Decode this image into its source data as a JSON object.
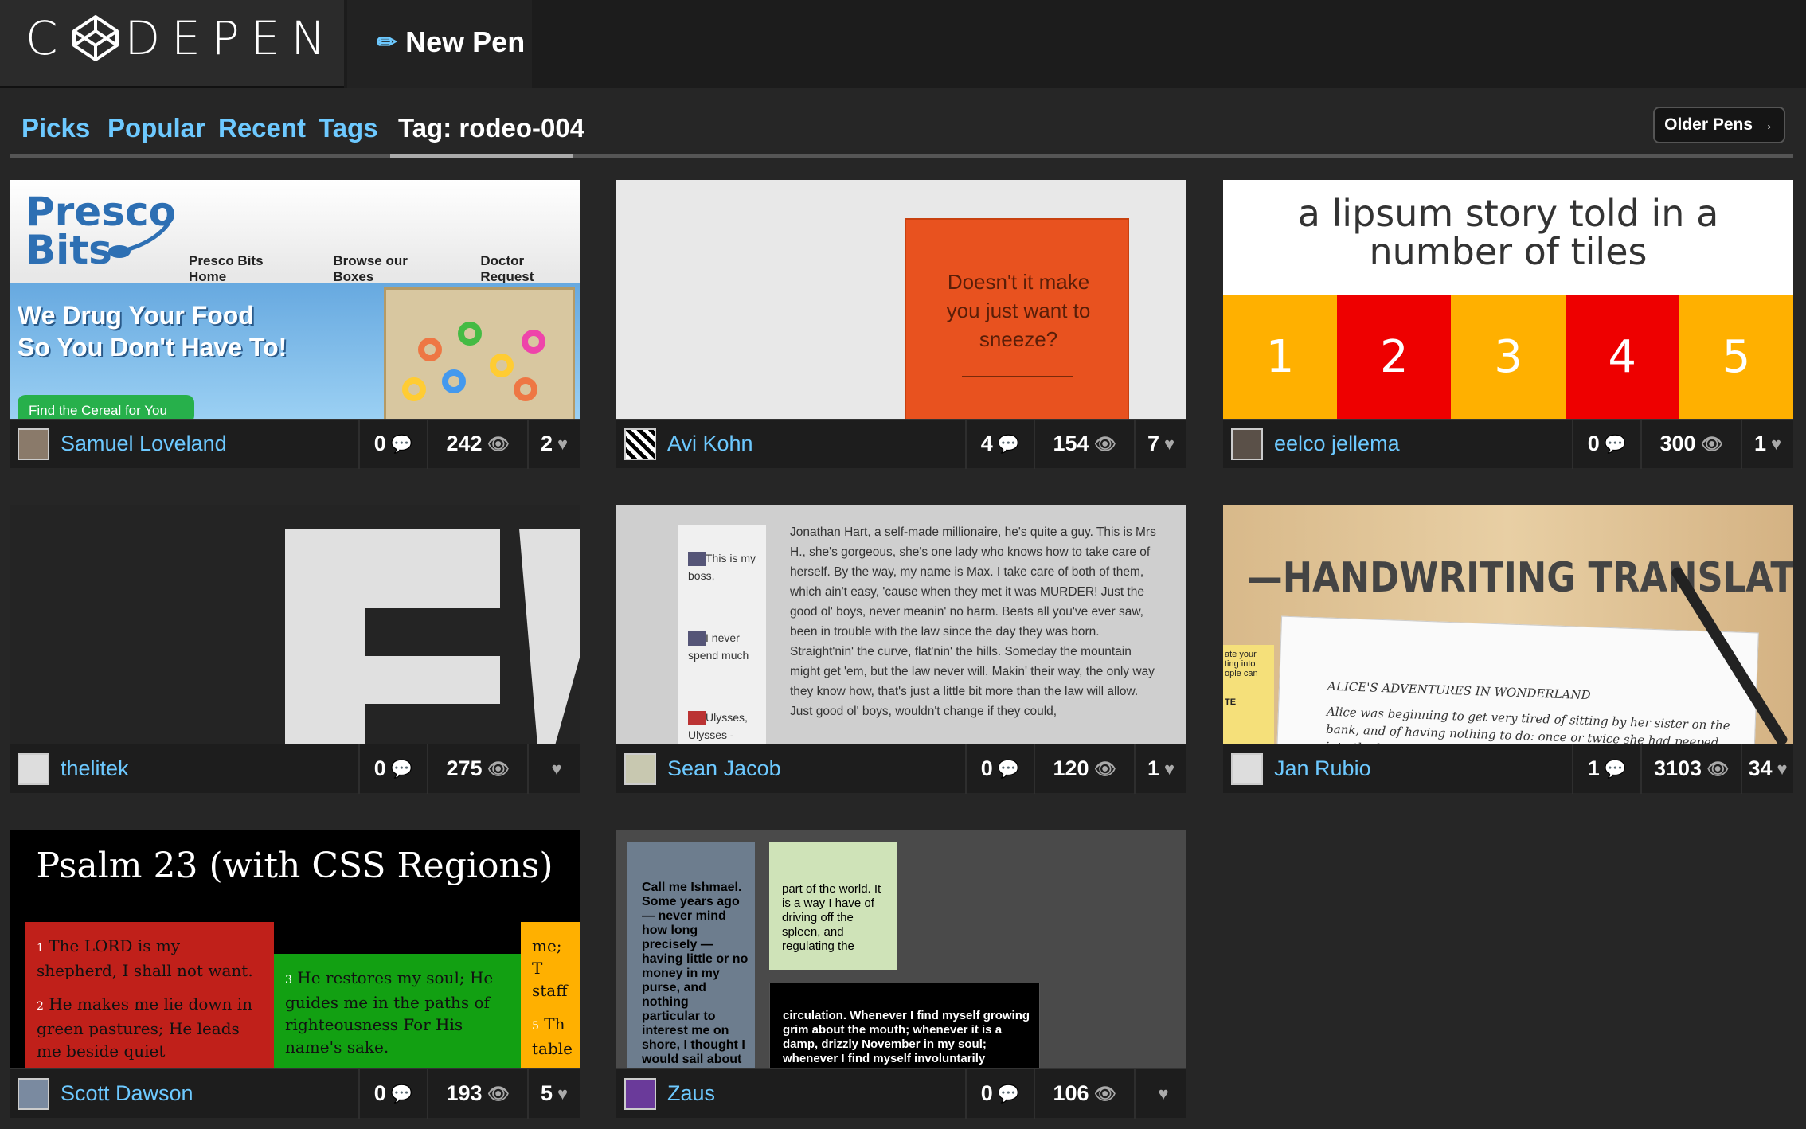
{
  "header": {
    "logo_text_1": "C",
    "logo_text_2": "DEPEN",
    "new_pen": "New Pen"
  },
  "nav": {
    "picks": "Picks",
    "popular": "Popular",
    "recent": "Recent",
    "tags": "Tags",
    "current_tag": "Tag: rodeo-004",
    "older": "Older Pens →"
  },
  "pens": [
    {
      "author": "Samuel Loveland",
      "comments": "0",
      "views": "242",
      "likes": "2"
    },
    {
      "author": "Avi Kohn",
      "comments": "4",
      "views": "154",
      "likes": "7"
    },
    {
      "author": "eelco jellema",
      "comments": "0",
      "views": "300",
      "likes": "1"
    },
    {
      "author": "thelitek",
      "comments": "0",
      "views": "275",
      "likes": ""
    },
    {
      "author": "Sean Jacob",
      "comments": "0",
      "views": "120",
      "likes": "1"
    },
    {
      "author": "Jan Rubio",
      "comments": "1",
      "views": "3103",
      "likes": "34"
    },
    {
      "author": "Scott Dawson",
      "comments": "0",
      "views": "193",
      "likes": "5"
    },
    {
      "author": "Zaus",
      "comments": "0",
      "views": "106",
      "likes": ""
    }
  ],
  "previews": {
    "presco": {
      "brand_1": "Presco",
      "brand_2": "Bits",
      "links": [
        "Presco Bits Home",
        "Browse our Boxes",
        "Doctor Request"
      ],
      "slogan_1": "We Drug Your Food",
      "slogan_2": "So You Don't Have To!",
      "button": "Find the Cereal for You"
    },
    "sneeze": {
      "text": "Doesn't it make you just want to sneeze?"
    },
    "lipsum": {
      "title": "a lipsum story told in a number of tiles",
      "tiles": [
        "1",
        "2",
        "3",
        "4",
        "5"
      ]
    },
    "hart": {
      "side": [
        "This is my boss,",
        "I never spend much",
        "Ulysses, Ulysses -"
      ],
      "prose": "Jonathan Hart, a self-made millionaire, he's quite a guy. This is Mrs H., she's gorgeous, she's one lady who knows how to take care of herself. By the way, my name is Max. I take care of both of them, which ain't easy, 'cause when they met it was MURDER! Just the good ol' boys, never meanin' no harm. Beats all you've ever saw, been in trouble with the law since the day they was born. Straight'nin' the curve, flat'nin' the hills. Someday the mountain might get 'em, but the law never will. Makin' their way, the only way they know how, that's just a little bit more than the law will allow. Just good ol' boys, wouldn't change if they could,"
    },
    "handwriting": {
      "title": "—HANDWRITING TRANSLATOR—",
      "note": "ate your ting into ople can",
      "note_2": "TE",
      "heading": "ALICE'S ADVENTURES IN WONDERLAND",
      "body": "Alice was beginning to get very tired of sitting by her sister on the bank, and of having nothing to do: once or twice she had peeped into the book her sister was"
    },
    "psalm": {
      "title": "Psalm 23 (with CSS Regions)",
      "col1": "The LORD is my shepherd, I shall not want.",
      "col1_num": "1",
      "col1b": "He makes me lie down in green pastures; He leads me beside quiet",
      "col1b_num": "2",
      "col2": "He restores my soul; He guides me in the paths of righteousness For His name's sake.",
      "col2_num": "3",
      "col3": "me; T staff",
      "col3b": "Th table prese",
      "col3b_num": "5"
    },
    "ishmael": {
      "b1": "Call me Ishmael. Some years ago — never mind how long precisely — having little or no money in my purse, and nothing particular to interest me on shore, I thought I would sail about a little and",
      "b2": "part of the world. It is a way I have of driving off the spleen, and regulating the",
      "b3": "circulation. Whenever I find myself growing grim about the mouth; whenever it is a damp, drizzly November in my soul; whenever I find myself involuntarily"
    }
  },
  "colors": {
    "link": "#6dc9ff",
    "tile_orange": "#ffb000",
    "tile_red": "#ee0000"
  }
}
